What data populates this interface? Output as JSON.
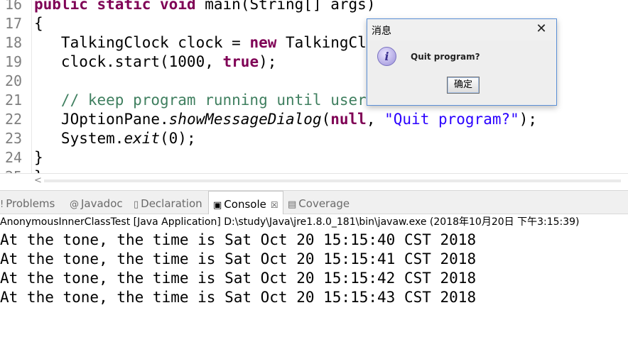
{
  "editor": {
    "lines": [
      {
        "n": "16",
        "tokens": [
          [
            "kw",
            "public"
          ],
          [
            "p",
            " "
          ],
          [
            "kw",
            "static"
          ],
          [
            "p",
            " "
          ],
          [
            "kw",
            "void"
          ],
          [
            "p",
            " main(String[] args)"
          ]
        ]
      },
      {
        "n": "17",
        "tokens": [
          [
            "p",
            "{"
          ]
        ]
      },
      {
        "n": "18",
        "tokens": [
          [
            "p",
            "   TalkingClock clock = "
          ],
          [
            "kw",
            "new"
          ],
          [
            "p",
            " TalkingClock("
          ]
        ]
      },
      {
        "n": "19",
        "tokens": [
          [
            "p",
            "   clock.start(1000, "
          ],
          [
            "kw",
            "true"
          ],
          [
            "p",
            ");"
          ]
        ]
      },
      {
        "n": "20",
        "tokens": []
      },
      {
        "n": "21",
        "tokens": [
          [
            "cmt",
            "   // keep program running until user selects \"Ok\""
          ]
        ]
      },
      {
        "n": "22",
        "tokens": [
          [
            "p",
            "   JOptionPane."
          ],
          [
            "it",
            "showMessageDialog"
          ],
          [
            "p",
            "("
          ],
          [
            "kw",
            "null"
          ],
          [
            "p",
            ", "
          ],
          [
            "str",
            "\"Quit program?\""
          ],
          [
            "p",
            ");"
          ]
        ]
      },
      {
        "n": "23",
        "tokens": [
          [
            "p",
            "   System."
          ],
          [
            "it",
            "exit"
          ],
          [
            "p",
            "(0);"
          ]
        ]
      },
      {
        "n": "24",
        "tokens": [
          [
            "p",
            "}"
          ]
        ]
      },
      {
        "n": "25",
        "tokens": [
          [
            "p",
            "}"
          ]
        ]
      }
    ]
  },
  "hscroll": {
    "left_arrow": "<"
  },
  "views": {
    "tabs": [
      {
        "label": "Problems",
        "icon": "!"
      },
      {
        "label": "Javadoc",
        "icon": "@"
      },
      {
        "label": "Declaration",
        "icon": "▯"
      },
      {
        "label": "Console",
        "icon": "▣",
        "close": "☒"
      },
      {
        "label": "Coverage",
        "icon": "▤"
      }
    ],
    "console_description": "AnonymousInnerClassTest [Java Application] D:\\study\\Java\\jre1.8.0_181\\bin\\javaw.exe (2018年10月20日 下午3:15:39)",
    "console_output": [
      "At the tone, the time is Sat Oct 20 15:15:40 CST 2018",
      "At the tone, the time is Sat Oct 20 15:15:41 CST 2018",
      "At the tone, the time is Sat Oct 20 15:15:42 CST 2018",
      "At the tone, the time is Sat Oct 20 15:15:43 CST 2018"
    ]
  },
  "dialog": {
    "title": "消息",
    "close_glyph": "✕",
    "icon_glyph": "i",
    "message": "Quit program?",
    "ok_label": "确定"
  },
  "colors": {
    "keyword": "#7f0055",
    "comment": "#3f7f5f",
    "string": "#2a00ff",
    "dialog_border": "#5a8fd6"
  }
}
